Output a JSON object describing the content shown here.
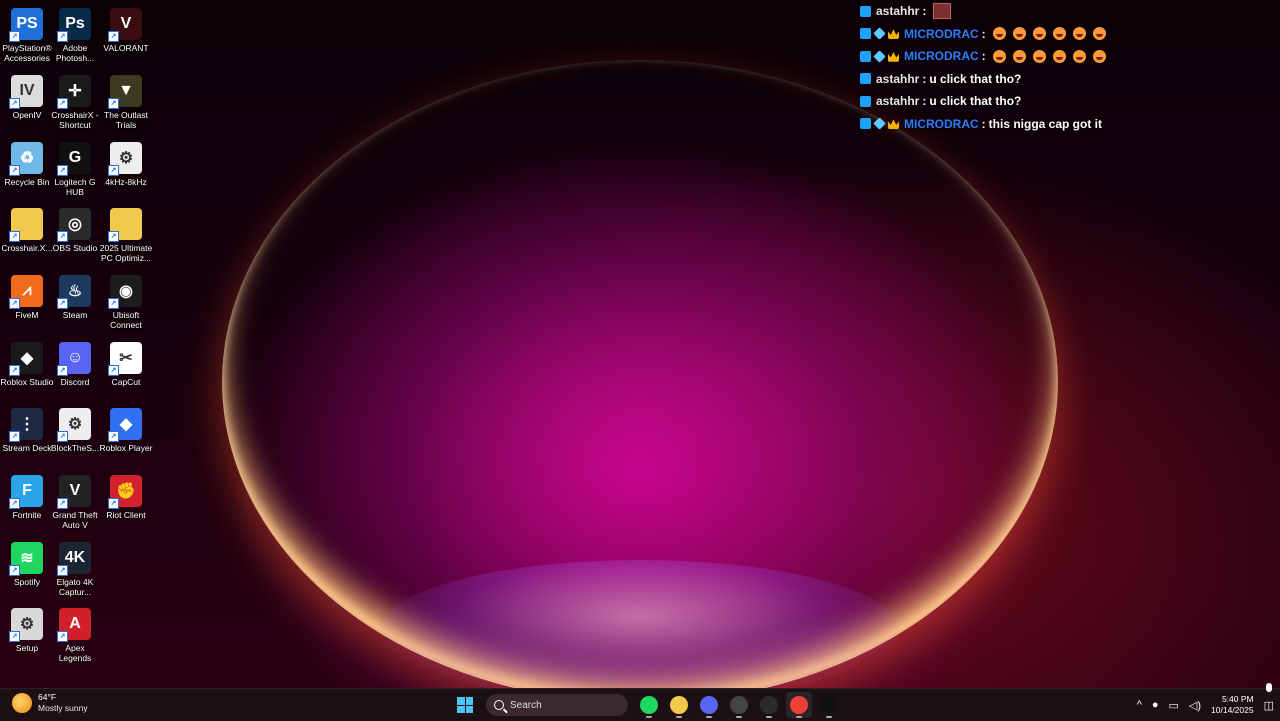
{
  "desktop": {
    "icons": [
      {
        "label": "PlayStation® Accessories",
        "color": "#1f6fd6",
        "glyph": "PS"
      },
      {
        "label": "Adobe Photosh...",
        "color": "#0a2a4a",
        "glyph": "Ps"
      },
      {
        "label": "VALORANT",
        "color": "#3a0d10",
        "glyph": "V"
      },
      {
        "label": "OpenIV",
        "color": "#dcdcdc",
        "glyph": "IV"
      },
      {
        "label": "CrosshairX - Shortcut",
        "color": "#1a1a1a",
        "glyph": "✛"
      },
      {
        "label": "The Outlast Trials",
        "color": "#3d3a22",
        "glyph": "▼"
      },
      {
        "label": "Recycle Bin",
        "color": "#6fb8e8",
        "glyph": "♻"
      },
      {
        "label": "Logitech G HUB",
        "color": "#111111",
        "glyph": "G"
      },
      {
        "label": "4kHz-8kHz",
        "color": "#eeeeee",
        "glyph": "⚙"
      },
      {
        "label": "Crosshair.X...",
        "color": "#f2c94c",
        "glyph": ""
      },
      {
        "label": "OBS Studio",
        "color": "#2b2b2b",
        "glyph": "◎"
      },
      {
        "label": "2025 Ultimate PC Optimiz...",
        "color": "#f2c94c",
        "glyph": ""
      },
      {
        "label": "FiveM",
        "color": "#f26b1d",
        "glyph": "⩘"
      },
      {
        "label": "Steam",
        "color": "#1b3a5c",
        "glyph": "♨"
      },
      {
        "label": "Ubisoft Connect",
        "color": "#1c1c1c",
        "glyph": "◉"
      },
      {
        "label": "Roblox Studio",
        "color": "#1a1a1a",
        "glyph": "◆"
      },
      {
        "label": "Discord",
        "color": "#5865f2",
        "glyph": "☺"
      },
      {
        "label": "CapCut",
        "color": "#ffffff",
        "glyph": "✂"
      },
      {
        "label": "Stream Deck",
        "color": "#1e2a44",
        "glyph": "⋮"
      },
      {
        "label": "BlockTheS...",
        "color": "#eeeeee",
        "glyph": "⚙"
      },
      {
        "label": "Roblox Player",
        "color": "#2f6ff0",
        "glyph": "◆"
      },
      {
        "label": "Fortnite",
        "color": "#2aa3e8",
        "glyph": "F"
      },
      {
        "label": "Grand Theft Auto V",
        "color": "#222222",
        "glyph": "V"
      },
      {
        "label": "Riot Client",
        "color": "#d3202e",
        "glyph": "✊"
      },
      {
        "label": "Spotify",
        "color": "#1ed760",
        "glyph": "≋"
      },
      {
        "label": "Elgato 4K Captur...",
        "color": "#1d2530",
        "glyph": "4K"
      },
      {
        "label": "",
        "color": "",
        "glyph": ""
      },
      {
        "label": "Setup",
        "color": "#d8d8d8",
        "glyph": "⚙"
      },
      {
        "label": "Apex Legends",
        "color": "#d0202a",
        "glyph": "A"
      }
    ]
  },
  "chat": {
    "lines": [
      {
        "user": "astahhr",
        "user_style": "gray",
        "badges": [
          "blue"
        ],
        "sep": ":",
        "text": "",
        "emotes": [
          "square"
        ]
      },
      {
        "user": "MICRODRAC",
        "user_style": "blue",
        "badges": [
          "blue",
          "cube",
          "crown"
        ],
        "sep": ":",
        "text": "",
        "emotes": [
          "laugh",
          "laugh",
          "laugh",
          "laugh",
          "laugh",
          "laugh"
        ]
      },
      {
        "user": "MICRODRAC",
        "user_style": "blue",
        "badges": [
          "blue",
          "cube",
          "crown"
        ],
        "sep": ":",
        "text": "",
        "emotes": [
          "laugh",
          "laugh",
          "laugh",
          "laugh",
          "laugh",
          "laugh"
        ]
      },
      {
        "user": "astahhr",
        "user_style": "gray",
        "badges": [
          "blue"
        ],
        "sep": ":",
        "text": "u click that tho?",
        "emotes": []
      },
      {
        "user": "astahhr",
        "user_style": "gray",
        "badges": [
          "blue"
        ],
        "sep": ":",
        "text": "u click that tho?",
        "emotes": []
      },
      {
        "user": "MICRODRAC",
        "user_style": "blue",
        "badges": [
          "blue",
          "cube",
          "crown"
        ],
        "sep": ":",
        "text": "this nigga cap got it",
        "emotes": []
      }
    ]
  },
  "taskbar": {
    "weather": {
      "temp": "64°F",
      "condition": "Mostly sunny"
    },
    "search_placeholder": "Search",
    "apps": [
      {
        "name": "spotify-taskbar-icon",
        "color": "#1ed760"
      },
      {
        "name": "file-explorer-taskbar-icon",
        "color": "#f2c94c"
      },
      {
        "name": "discord-taskbar-icon",
        "color": "#5865f2"
      },
      {
        "name": "obs-taskbar-icon",
        "color": "#444444"
      },
      {
        "name": "epic-games-taskbar-icon",
        "color": "#2a2a2a"
      },
      {
        "name": "chrome-taskbar-icon",
        "color": "#e94235"
      },
      {
        "name": "logitech-taskbar-icon",
        "color": "#111111"
      }
    ],
    "time": "5:40 PM",
    "date": "10/14/2025"
  }
}
